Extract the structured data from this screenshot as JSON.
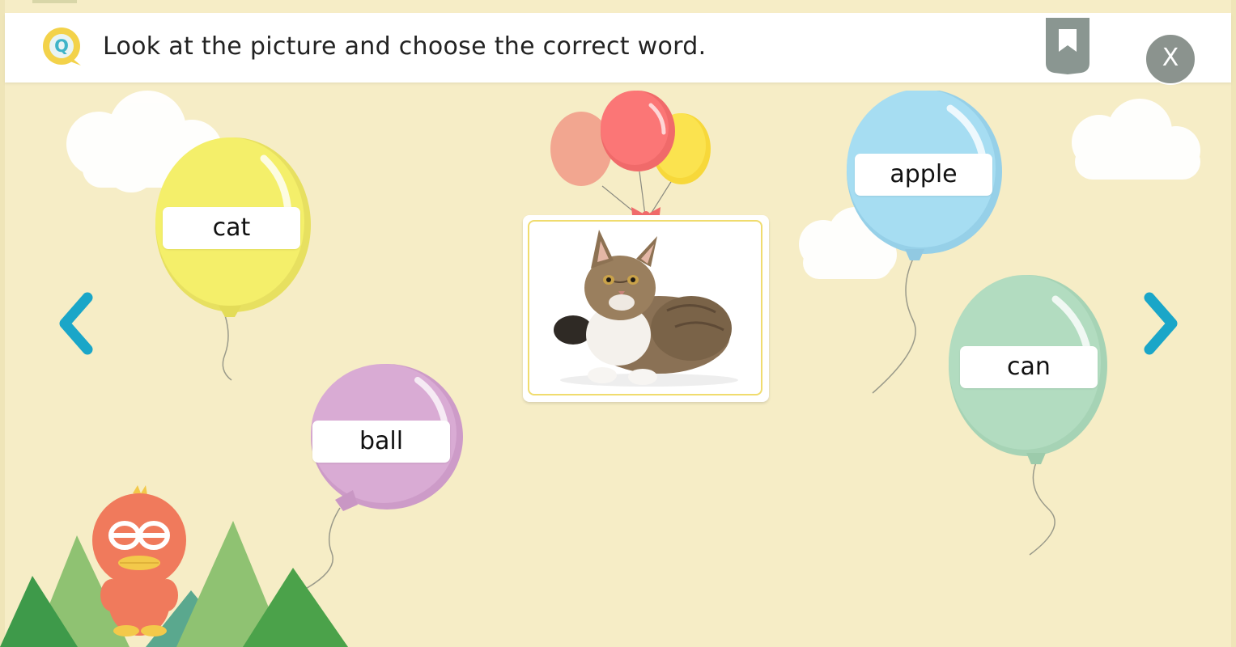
{
  "header": {
    "badge_letter": "Q",
    "question": "Look at the picture and choose the correct word.",
    "close_label": "X",
    "bookmark_icon": "bookmark-icon"
  },
  "choices": [
    {
      "id": "cat",
      "label": "cat",
      "color": "#f4ef6a"
    },
    {
      "id": "ball",
      "label": "ball",
      "color": "#d9abd4"
    },
    {
      "id": "apple",
      "label": "apple",
      "color": "#a6ddf2"
    },
    {
      "id": "can",
      "label": "can",
      "color": "#b2dcc0"
    }
  ],
  "picture": {
    "subject": "cat-photo"
  },
  "navigation": {
    "prev_icon": "chevron-left-icon",
    "next_icon": "chevron-right-icon"
  },
  "colors": {
    "background": "#f6edc6",
    "accent": "#1aa6c8",
    "badge": "#f3d24a",
    "mascot": "#f07a5c",
    "mountains": "#7fba65"
  }
}
